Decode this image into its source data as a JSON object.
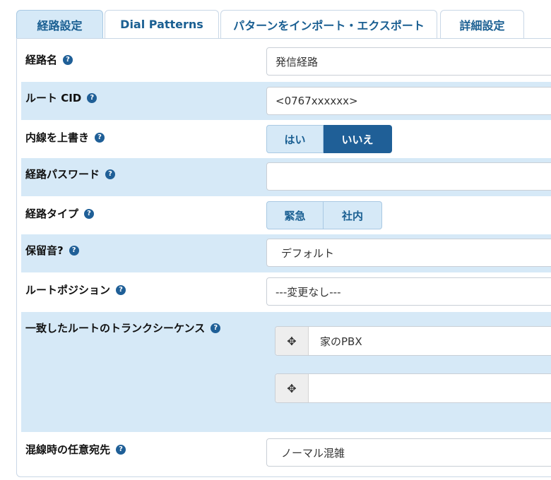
{
  "tabs": [
    {
      "label": "経路設定",
      "active": true
    },
    {
      "label": "Dial Patterns",
      "active": false
    },
    {
      "label": "パターンをインポート・エクスポート",
      "active": false
    },
    {
      "label": "詳細設定",
      "active": false
    }
  ],
  "help_glyph": "?",
  "fields": {
    "route_name": {
      "label": "経路名",
      "value": "発信経路"
    },
    "route_cid": {
      "label": "ルート CID",
      "value": "<0767xxxxxx>"
    },
    "override_extension": {
      "label": "内線を上書き",
      "options": [
        "はい",
        "いいえ"
      ],
      "selected": "いいえ"
    },
    "route_password": {
      "label": "経路パスワード",
      "value": ""
    },
    "route_type": {
      "label": "経路タイプ",
      "options": [
        "緊急",
        "社内"
      ],
      "selected": ""
    },
    "music_on_hold": {
      "label": "保留音?",
      "value": "デフォルト"
    },
    "route_position": {
      "label": "ルートポジション",
      "value": "---変更なし---"
    },
    "trunk_sequence": {
      "label": "一致したルートのトランクシーケンス",
      "trunks": [
        "家のPBX",
        ""
      ]
    },
    "congestion_destination": {
      "label": "混線時の任意宛先",
      "value": "ノーマル混雑"
    }
  },
  "icons": {
    "help": "help-circle-icon",
    "drag": "move-arrows-icon"
  },
  "colors": {
    "accent": "#1f5f97",
    "shade": "#d6e9f7",
    "tab_text": "#1a5f92"
  }
}
